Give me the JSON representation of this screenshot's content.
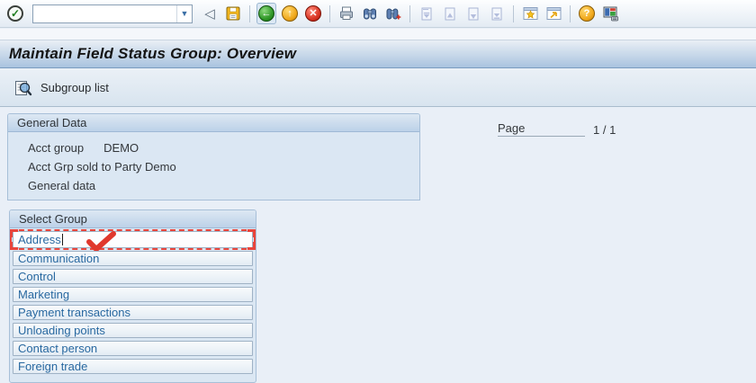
{
  "toolbar": {
    "command_value": "",
    "buttons": [
      {
        "name": "enter",
        "glyph": "✓"
      },
      {
        "name": "back-nav",
        "glyph": "◁"
      },
      {
        "name": "save",
        "glyph": "floppy-disk"
      },
      {
        "name": "back",
        "glyph": "←"
      },
      {
        "name": "exit",
        "glyph": "↑"
      },
      {
        "name": "cancel",
        "glyph": "✕"
      },
      {
        "name": "print",
        "glyph": "printer"
      },
      {
        "name": "find",
        "glyph": "binoculars"
      },
      {
        "name": "find-next",
        "glyph": "binoculars-plus"
      },
      {
        "name": "first-page",
        "glyph": "page-first"
      },
      {
        "name": "page-up",
        "glyph": "page-up"
      },
      {
        "name": "page-down",
        "glyph": "page-down"
      },
      {
        "name": "last-page",
        "glyph": "page-last"
      },
      {
        "name": "new-session",
        "glyph": "window-star"
      },
      {
        "name": "create-shortcut",
        "glyph": "window-arrow"
      },
      {
        "name": "help",
        "glyph": "?"
      },
      {
        "name": "customize-layout",
        "glyph": "monitor"
      }
    ],
    "glyphs": {
      "enter": "✓",
      "dropdown": "▼",
      "back_nav": "◁",
      "back": "←",
      "exit": "↑",
      "cancel": "✕",
      "help": "?"
    }
  },
  "title_bar": {
    "title": "Maintain Field Status Group: Overview"
  },
  "app_toolbar": {
    "subgroup_list_label": "Subgroup list",
    "icon": "magnifier-list"
  },
  "general_data": {
    "header": "General Data",
    "rows": [
      {
        "label": "Acct group",
        "value": "DEMO"
      },
      {
        "label": "Acct Grp sold to Party Demo",
        "value": ""
      },
      {
        "label": "General data",
        "value": ""
      }
    ]
  },
  "page_field": {
    "label": "Page",
    "value": "1 / 1"
  },
  "select_group": {
    "header": "Select Group",
    "items": [
      "Address",
      "Communication",
      "Control",
      "Marketing",
      "Payment transactions",
      "Unloading points",
      "Contact person",
      "Foreign trade"
    ],
    "selected": "Address",
    "selected_annotation": "red-dashed-box-with-checkmark"
  },
  "colors": {
    "accent_blue": "#2868a0",
    "box_header_from": "#dde8f3",
    "box_header_to": "#bcd1e8",
    "content_bg": "#e9eff7",
    "annotation_red": "#e8453c",
    "titlebar_to": "#a9c3df"
  }
}
